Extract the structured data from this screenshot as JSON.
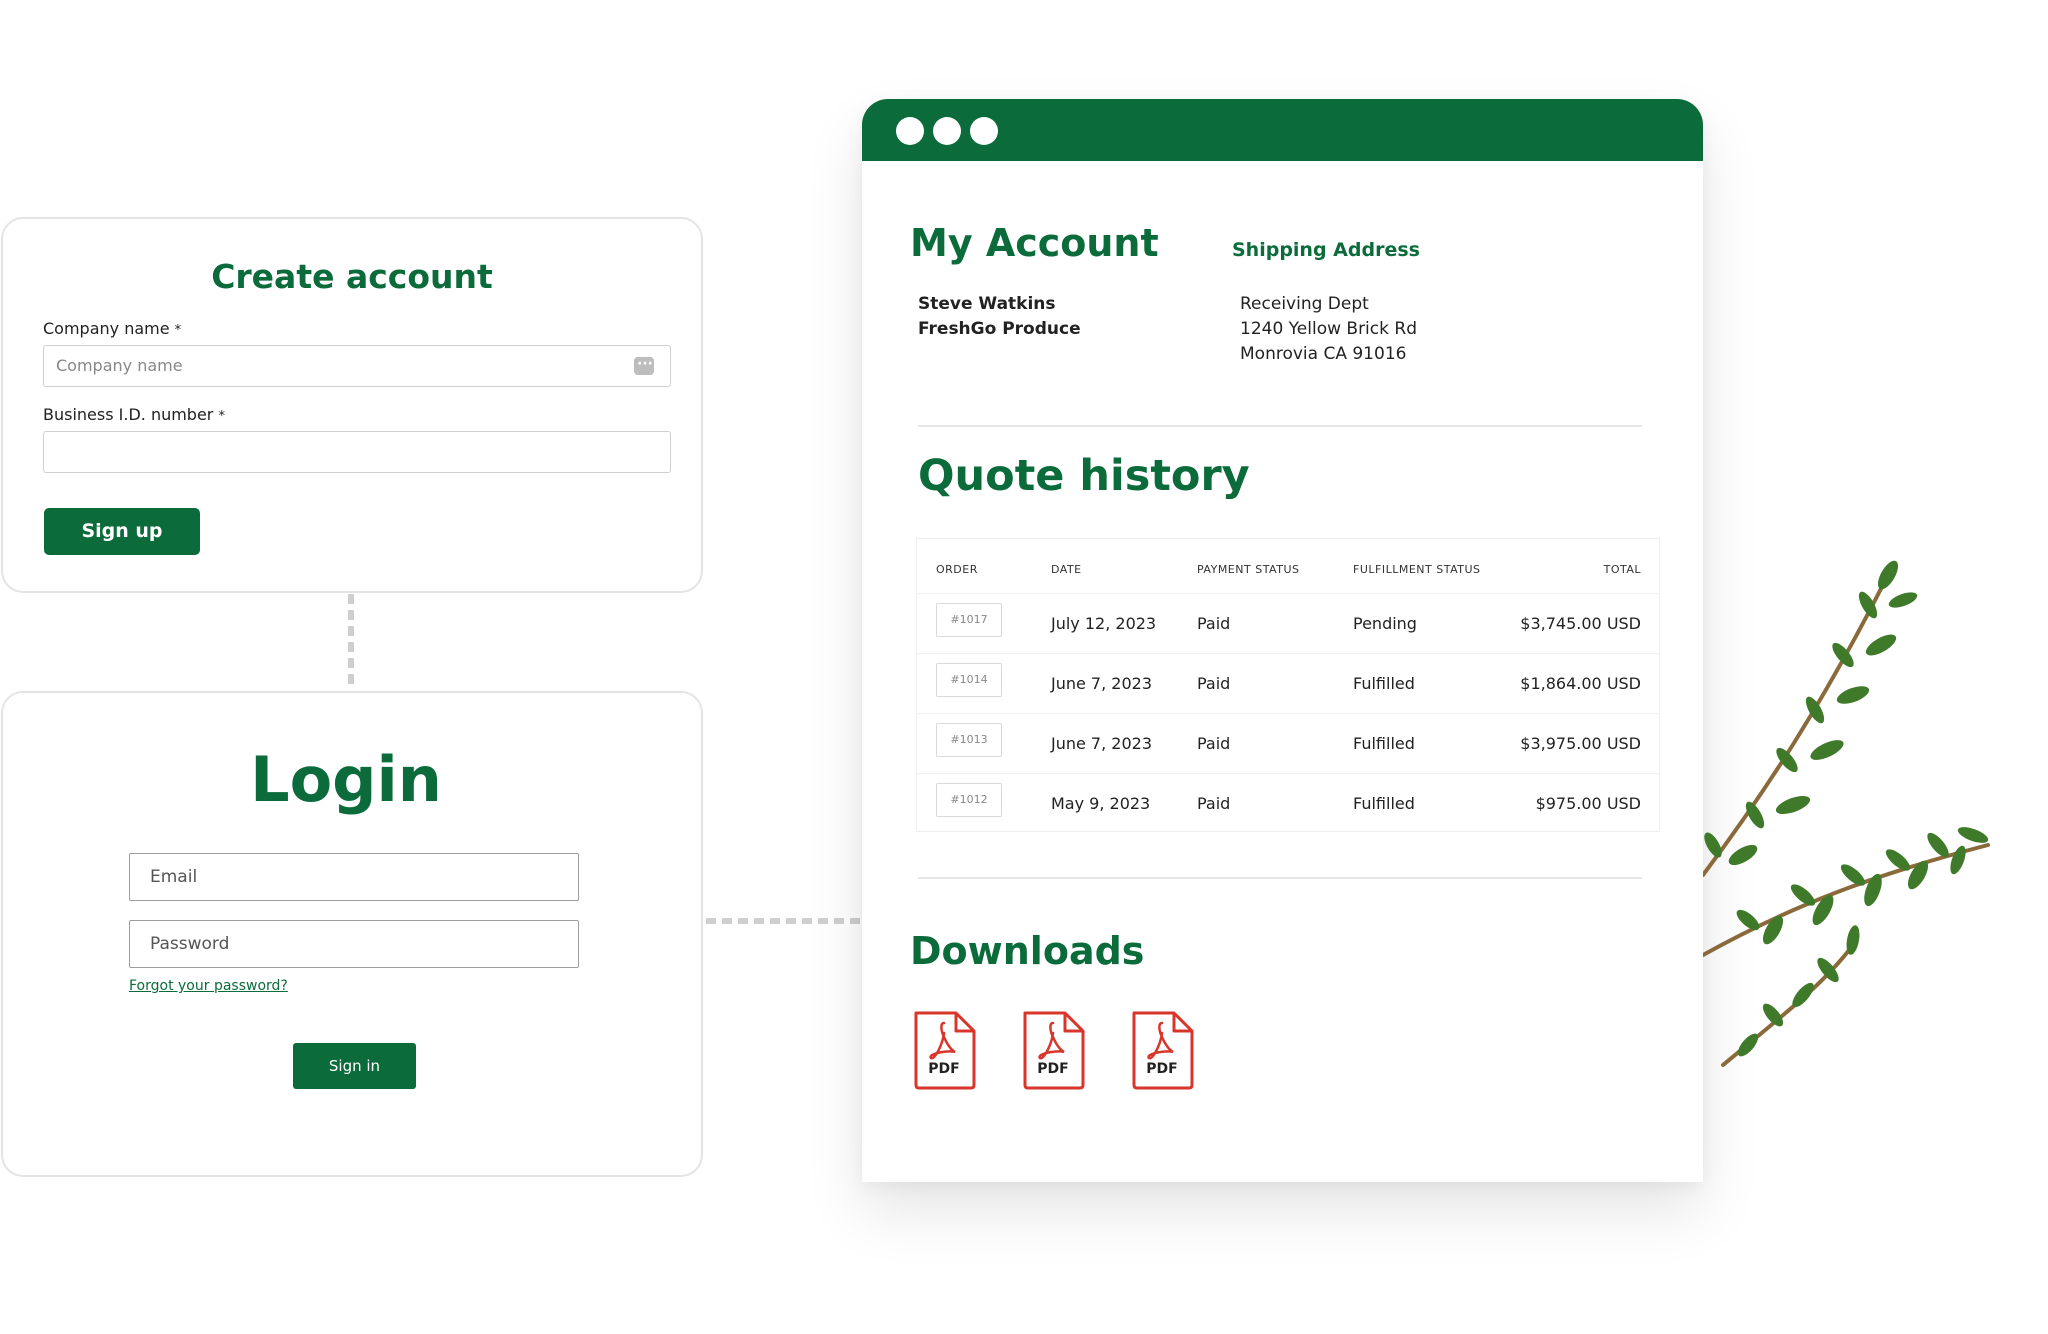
{
  "create_account": {
    "title": "Create account",
    "company_label": "Company name",
    "company_placeholder": "Company name",
    "business_label": "Business I.D. number",
    "required_mark": "*",
    "signup_label": "Sign up"
  },
  "login": {
    "title": "Login",
    "email_placeholder": "Email",
    "password_placeholder": "Password",
    "forgot_label": "Forgot your password?",
    "signin_label": "Sign in"
  },
  "account": {
    "title": "My Account",
    "name": "Steve Watkins",
    "company": "FreshGo Produce",
    "shipping_title": "Shipping Address",
    "shipping_lines": [
      "Receiving Dept",
      "1240 Yellow Brick Rd",
      "Monrovia CA 91016"
    ]
  },
  "quotes": {
    "title": "Quote history",
    "headers": [
      "ORDER",
      "DATE",
      "PAYMENT STATUS",
      "FULFILLMENT STATUS",
      "TOTAL"
    ],
    "rows": [
      {
        "order": "#1017",
        "date": "July 12, 2023",
        "payment": "Paid",
        "fulfillment": "Pending",
        "total": "$3,745.00 USD"
      },
      {
        "order": "#1014",
        "date": "June 7, 2023",
        "payment": "Paid",
        "fulfillment": "Fulfilled",
        "total": "$1,864.00 USD"
      },
      {
        "order": "#1013",
        "date": "June 7, 2023",
        "payment": "Paid",
        "fulfillment": "Fulfilled",
        "total": "$3,975.00 USD"
      },
      {
        "order": "#1012",
        "date": "May 9, 2023",
        "payment": "Paid",
        "fulfillment": "Fulfilled",
        "total": "$975.00 USD"
      }
    ]
  },
  "downloads": {
    "title": "Downloads",
    "files": [
      {
        "label": "PDF",
        "icon": "pdf-icon"
      },
      {
        "label": "PDF",
        "icon": "pdf-icon"
      },
      {
        "label": "PDF",
        "icon": "pdf-icon"
      }
    ]
  },
  "colors": {
    "brand_green": "#0b6b3a",
    "pdf_red": "#d9362b"
  }
}
